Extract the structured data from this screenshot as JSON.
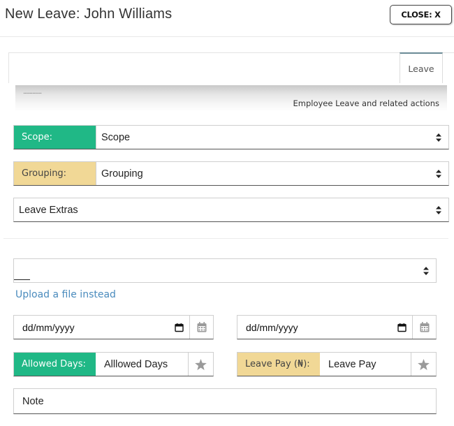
{
  "header": {
    "title": "New Leave: John Williams",
    "close_label": "CLOSE: X"
  },
  "tabs": [
    {
      "label": "Leave"
    }
  ],
  "banner": {
    "dots": "..............",
    "subtitle": "Employee Leave and related actions"
  },
  "form": {
    "scope": {
      "label": "Scope:",
      "value": "Scope"
    },
    "grouping": {
      "label": "Grouping:",
      "value": "Grouping"
    },
    "leave_extras": {
      "value": "Leave Extras"
    },
    "file_select": {
      "value": ""
    },
    "upload_link": "Upload a file instead",
    "start_date": {
      "placeholder": "dd/mm/yyyy"
    },
    "end_date": {
      "placeholder": "dd/mm/yyyy"
    },
    "allowed_days": {
      "label": "Allowed Days:",
      "placeholder": "Alllowed Days"
    },
    "leave_pay": {
      "label": "Leave Pay (₦):",
      "placeholder": "Leave Pay"
    },
    "note": {
      "placeholder": "Note"
    }
  },
  "colors": {
    "green": "#20b886",
    "yellow": "#f1d896",
    "link": "#4a8bbd"
  },
  "icons": [
    "updown-arrows-icon",
    "calendar-icon",
    "star-icon"
  ]
}
